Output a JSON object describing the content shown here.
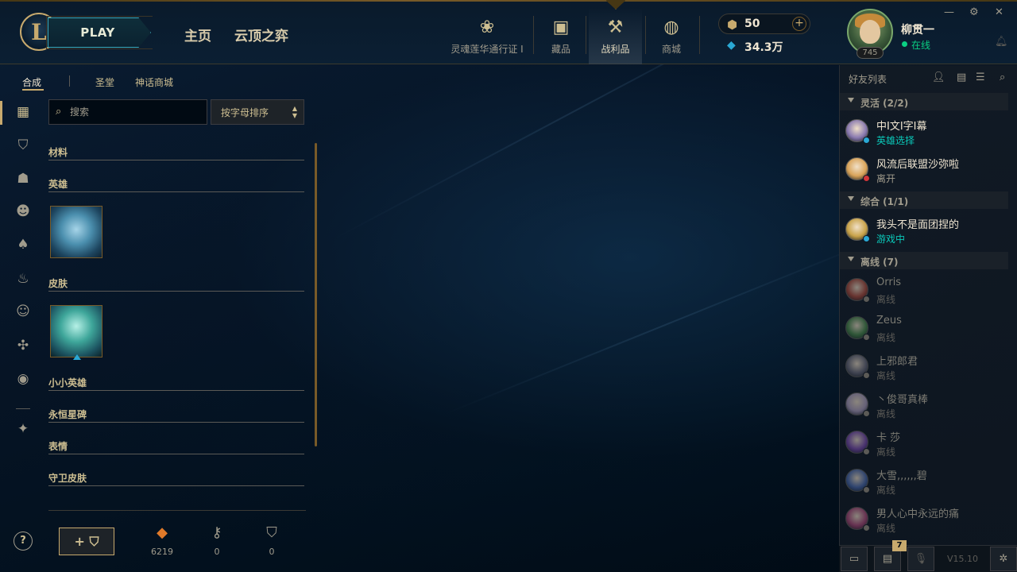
{
  "topbar": {
    "logo_letter": "L",
    "play_label": "PLAY",
    "nav": [
      "主页",
      "云顶之弈"
    ],
    "icons": [
      {
        "icon": "lotus-icon",
        "glyph": "❀",
        "label": "灵魂莲华通行证 I"
      },
      {
        "icon": "shop-bag-icon",
        "glyph": "▣",
        "label": "藏品"
      },
      {
        "icon": "loot-icon",
        "glyph": "⚒",
        "label": "战利品"
      },
      {
        "icon": "coins-icon",
        "glyph": "◍",
        "label": "商城"
      }
    ],
    "active_tab": "战利品",
    "rp_value": "50",
    "rp_plus": "+",
    "be_value": "34.3万",
    "username": "柳贯一",
    "status": "在线",
    "level": "745",
    "window_controls": [
      "—",
      "⚙",
      "✕"
    ]
  },
  "subtabs": {
    "items": [
      "合成",
      "圣堂",
      "神话商城"
    ],
    "active": "合成"
  },
  "search": {
    "placeholder": "搜索",
    "value": ""
  },
  "sort": {
    "label": "按字母排序",
    "arrows_up": "▲",
    "arrows_down": "▼"
  },
  "sections": {
    "materials": "材料",
    "champions": "英雄",
    "skins": "皮肤",
    "little_legends": "小小英雄",
    "eternals": "永恒星碑",
    "emotes": "表情",
    "ward_skins": "守卫皮肤"
  },
  "bottom": {
    "help": "?",
    "add_chest": "+ ⛉",
    "resources": [
      {
        "icon": "orange-essence-icon",
        "glyph": "◆",
        "value": "6219",
        "color": "#e07a2a"
      },
      {
        "icon": "key-icon",
        "glyph": "⚷",
        "value": "0",
        "color": "#a09b8c"
      },
      {
        "icon": "chest-icon",
        "glyph": "⛉",
        "value": "0",
        "color": "#a09b8c"
      }
    ]
  },
  "friends": {
    "title": "好友列表",
    "groups": [
      {
        "label": "灵活 (2/2)"
      },
      {
        "label": "综合 (1/1)"
      },
      {
        "label": "离线 (7)"
      }
    ],
    "items": [
      {
        "name": "中I文I字I幕",
        "status": "英雄选择",
        "status_color": "#0ac8b9",
        "dot": "#2aa8d4",
        "avatar": "#8a7ab0"
      },
      {
        "name": "风流后联盟沙弥啦",
        "status": "离开",
        "status_color": "#a09b8c",
        "dot": "#d13639",
        "avatar": "#d9a45a"
      },
      {
        "name": "我头不是面团捏的",
        "status": "游戏中",
        "status_color": "#0ac8b9",
        "dot": "#2aa8d4",
        "avatar": "#c9a34a"
      },
      {
        "name": "Orris",
        "status": "离线",
        "status_color": "#5b5a56",
        "dot": "#5b5a56",
        "avatar": "#b04a3a"
      },
      {
        "name": "Zeus",
        "status": "离线",
        "status_color": "#5b5a56",
        "dot": "#5b5a56",
        "avatar": "#4a8a4a"
      },
      {
        "name": "上邪郎君",
        "status": "离线",
        "status_color": "#5b5a56",
        "dot": "#5b5a56",
        "avatar": "#6a6a7a"
      },
      {
        "name": "丶俊哥真棒",
        "status": "离线",
        "status_color": "#5b5a56",
        "dot": "#5b5a56",
        "avatar": "#b0a0c0"
      },
      {
        "name": "卡 莎",
        "status": "离线",
        "status_color": "#5b5a56",
        "dot": "#5b5a56",
        "avatar": "#7a4ab0"
      },
      {
        "name": "大雪,,,,,,碧",
        "status": "离线",
        "status_color": "#5b5a56",
        "dot": "#5b5a56",
        "avatar": "#4a6ab0"
      },
      {
        "name": "男人心中永远的痛",
        "status": "离线",
        "status_color": "#5b5a56",
        "dot": "#5b5a56",
        "avatar": "#b04a7a"
      }
    ],
    "bottom_badge": "7",
    "version": "V15.10"
  }
}
